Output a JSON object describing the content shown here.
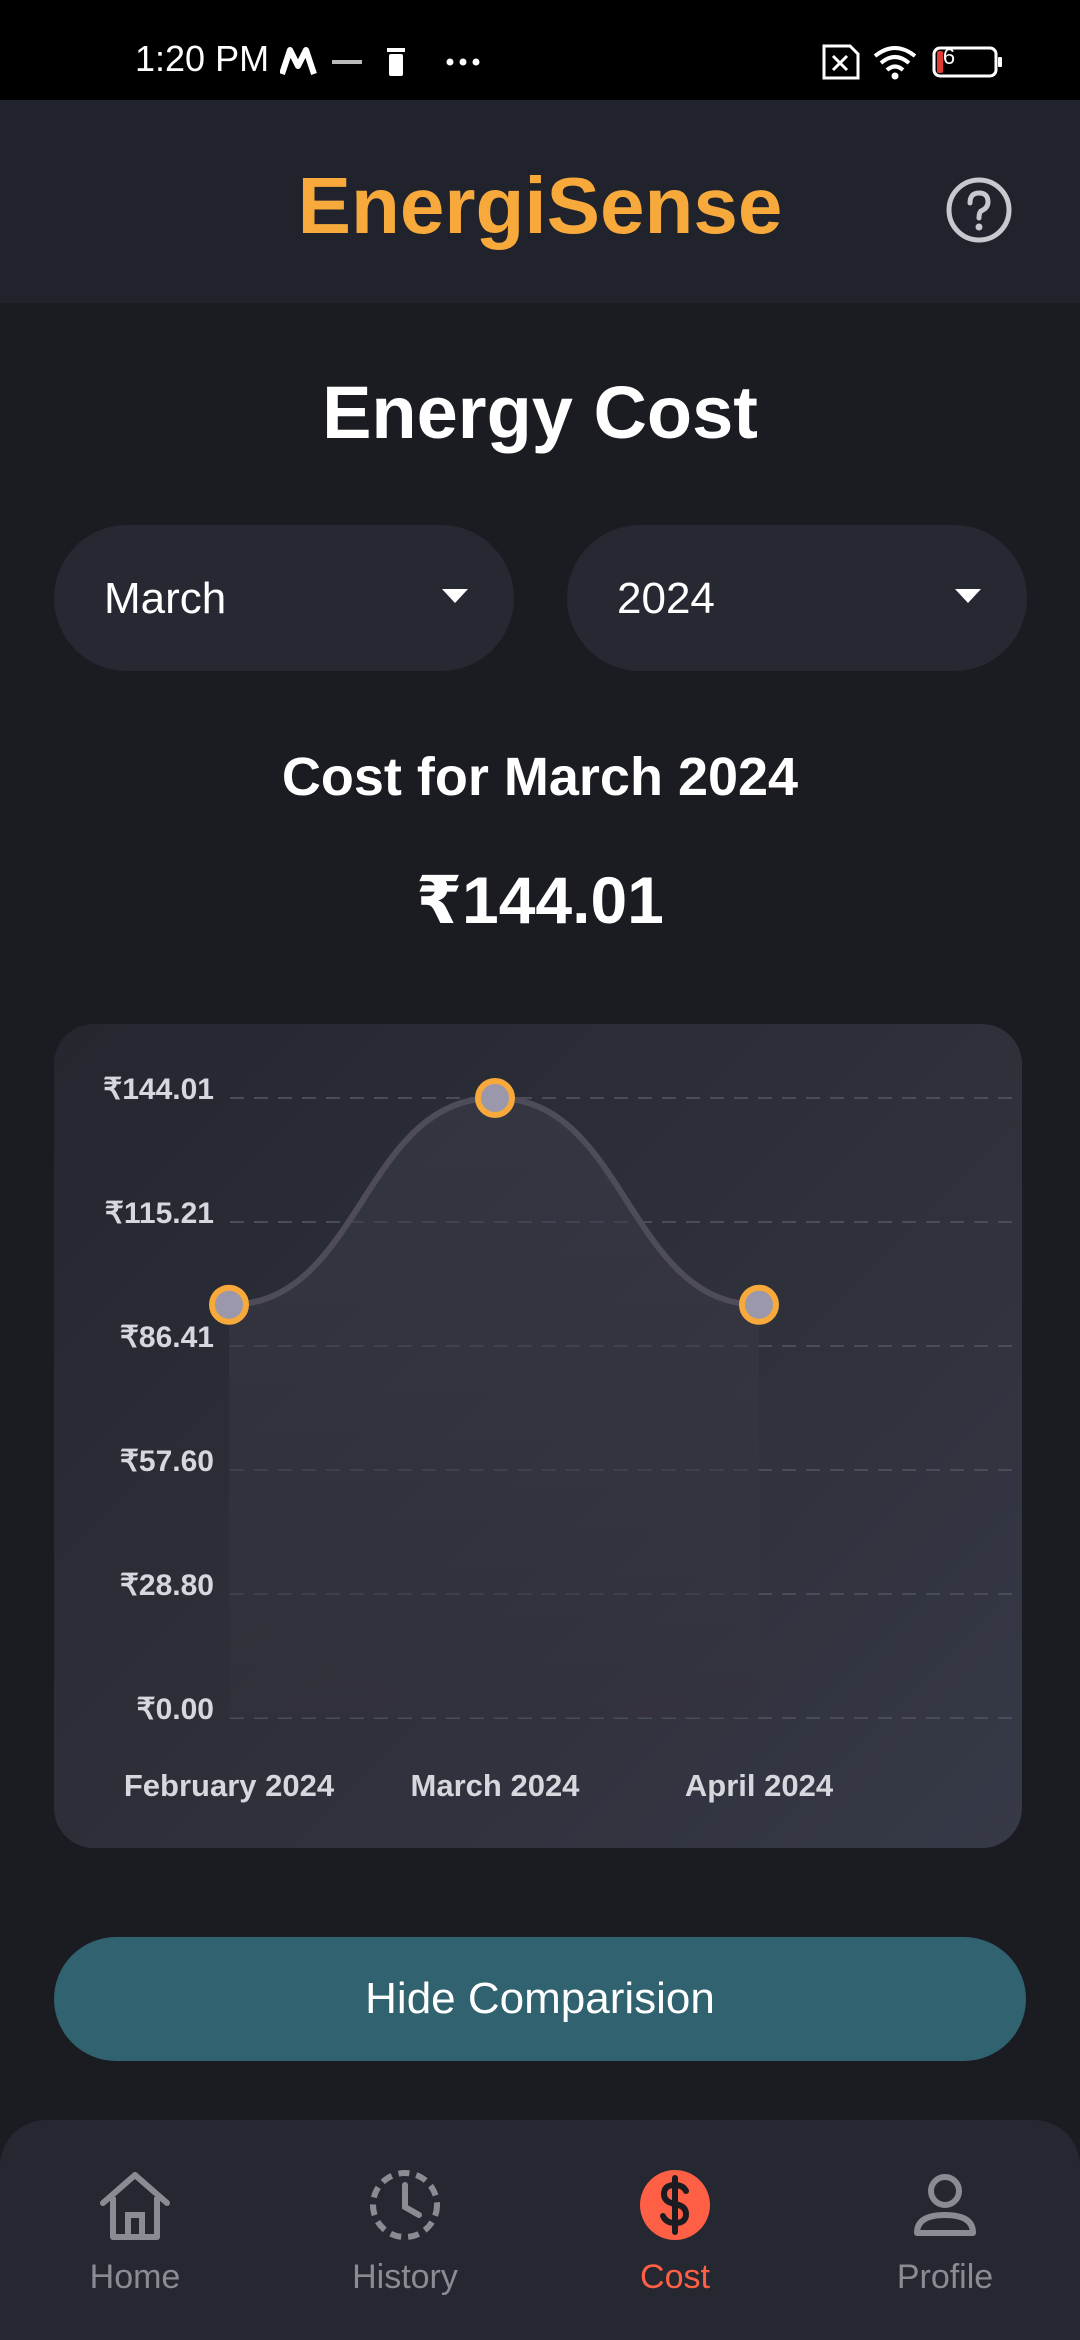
{
  "status_bar": {
    "time": "1:20 PM",
    "battery": "6",
    "icons": [
      "m-icon",
      "carrier-icon",
      "trash-icon",
      "more-dots-icon",
      "sim-error-icon",
      "wifi-icon",
      "battery-icon"
    ]
  },
  "header": {
    "app_title": "EnergiSense",
    "help_icon": "help-circle-icon",
    "accent_color": "#f7a93b"
  },
  "page": {
    "title": "Energy Cost",
    "month_select": {
      "value": "March"
    },
    "year_select": {
      "value": "2024"
    },
    "cost_heading": "Cost for March 2024",
    "cost_value": "₹144.01"
  },
  "chart_data": {
    "type": "area",
    "x": [
      "February 2024",
      "March 2024",
      "April 2024"
    ],
    "values": [
      96.0,
      144.01,
      96.0
    ],
    "y_ticks": [
      "₹0.00",
      "₹28.80",
      "₹57.60",
      "₹86.41",
      "₹115.21",
      "₹144.01"
    ],
    "ylim": [
      0,
      144.01
    ],
    "grid": true,
    "point_color": "#f7a93b"
  },
  "actions": {
    "hide_comparison": "Hide Comparision"
  },
  "bottom_nav": {
    "items": [
      {
        "label": "Home",
        "icon": "home-icon"
      },
      {
        "label": "History",
        "icon": "history-icon"
      },
      {
        "label": "Cost",
        "icon": "dollar-icon",
        "active": true
      },
      {
        "label": "Profile",
        "icon": "profile-icon"
      }
    ],
    "active_color": "#ff5f45"
  }
}
